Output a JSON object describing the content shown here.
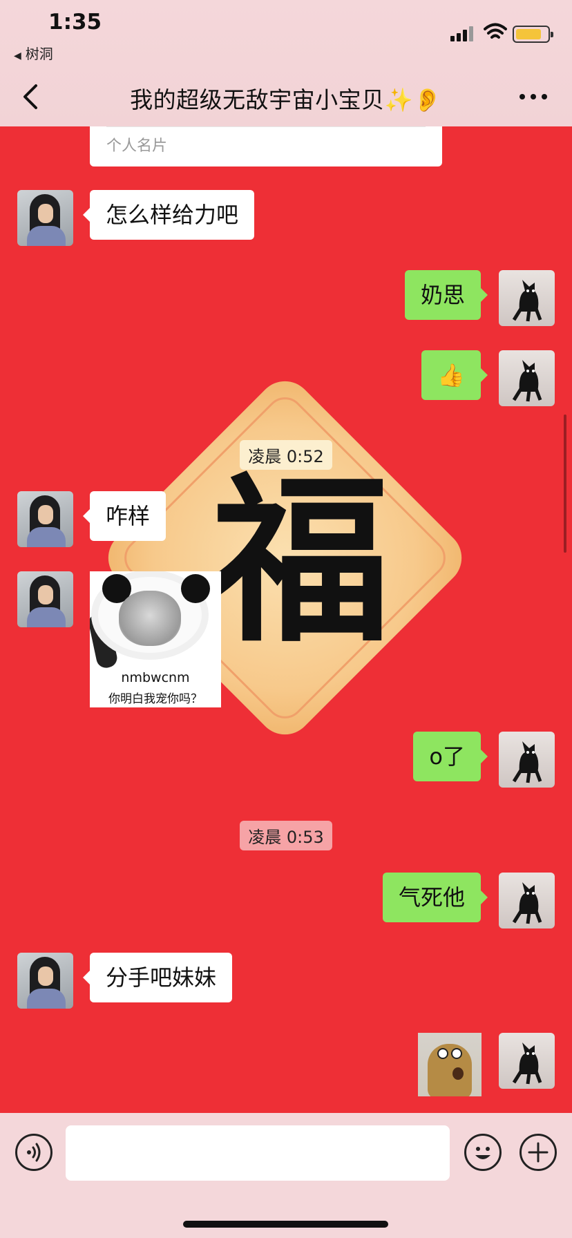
{
  "status_bar": {
    "time": "1:35",
    "back_app_label": "树洞"
  },
  "nav": {
    "title": "我的超级无敌宇宙小宝贝✨👂"
  },
  "card": {
    "label": "个人名片"
  },
  "messages": [
    {
      "side": "left",
      "text": "怎么样给力吧"
    },
    {
      "side": "right",
      "text": "奶思"
    },
    {
      "side": "right",
      "text": "👍"
    },
    {
      "side": "left",
      "text": "咋样"
    },
    {
      "side": "left",
      "type": "image",
      "caption1": "nmbwcnm",
      "caption2": "你明白我宠你吗？"
    },
    {
      "side": "right",
      "text": "o了"
    },
    {
      "side": "right",
      "text": "气死他"
    },
    {
      "side": "left",
      "text": "分手吧妹妹"
    },
    {
      "side": "right",
      "type": "sticker"
    }
  ],
  "timestamps": [
    "凌晨 0:52",
    "凌晨 0:53"
  ],
  "background_decoration": {
    "character": "福",
    "color": "#ee2f36"
  },
  "colors": {
    "background": "#ee2f36",
    "my_bubble": "#8ee560",
    "their_bubble": "#ffffff",
    "bars": "#f4d7da"
  },
  "input": {
    "value": ""
  },
  "icons": [
    "chevron-left-icon",
    "more-dots-icon",
    "signal-icon",
    "wifi-icon",
    "battery-icon",
    "voice-icon",
    "emoji-icon",
    "plus-icon"
  ]
}
